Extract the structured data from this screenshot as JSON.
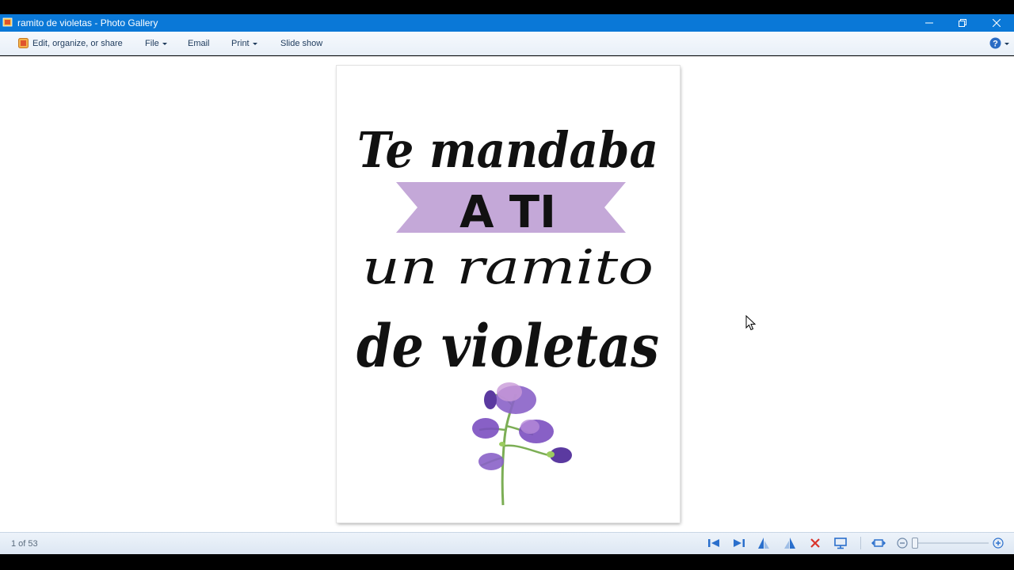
{
  "window": {
    "title": "ramito de violetas - Photo Gallery",
    "titlebar_color": "#0a78d7",
    "controls": [
      "minimize-icon",
      "restore-icon",
      "close-icon"
    ]
  },
  "menubar": {
    "items": [
      {
        "label": "Edit, organize, or share",
        "icon": "edit-icon"
      },
      {
        "label": "File",
        "has_dropdown": true
      },
      {
        "label": "Email"
      },
      {
        "label": "Print",
        "has_dropdown": true
      },
      {
        "label": "Slide show"
      }
    ],
    "help_icon": "help-icon"
  },
  "photo": {
    "line1": "Te mandaba",
    "banner": "A TI",
    "line3": "un ramito",
    "line4": "de violetas",
    "banner_color": "#c4a8d8",
    "flower_color": "#7b4fc0",
    "illustration": "violet-flower-icon"
  },
  "statusbar": {
    "counter": "1 of 53",
    "tools": [
      "previous-icon",
      "next-icon",
      "rotate-left-icon",
      "rotate-right-icon",
      "delete-icon",
      "slideshow-icon",
      "fit-icon",
      "zoom-out-icon",
      "zoom-in-icon"
    ]
  }
}
